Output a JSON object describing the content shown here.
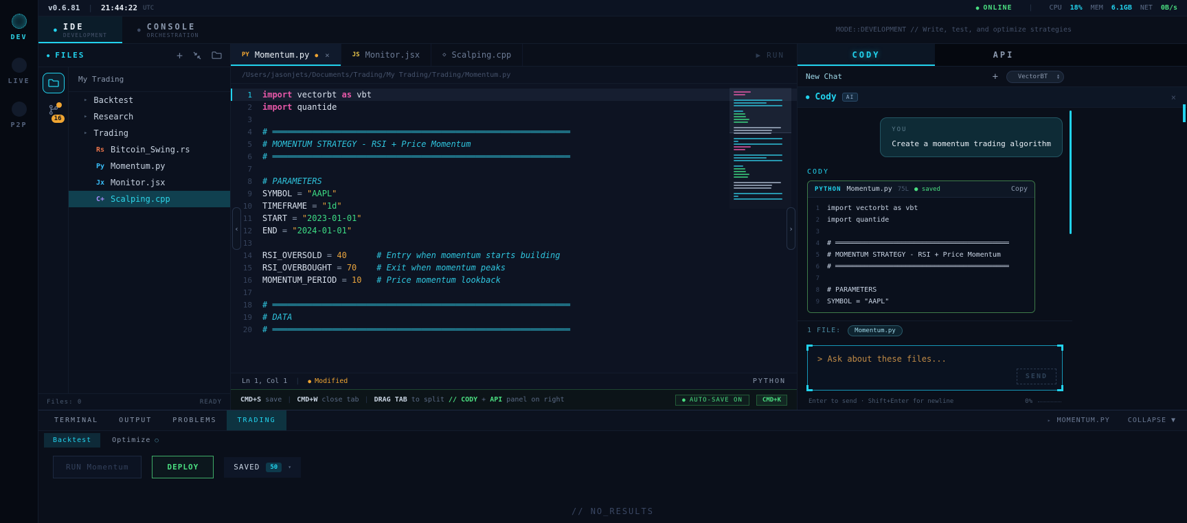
{
  "icons": {
    "close": "×",
    "plus": "+",
    "caret_right": "▸",
    "caret_down": "▾",
    "chevron_left": "‹",
    "chevron_right": "›",
    "dot": "●",
    "run": "▶",
    "diamond": "◇",
    "circle": "○",
    "collapse_caret": "▼",
    "divider": "|"
  },
  "colors": {
    "accent": "#22d3ee",
    "green": "#4ade80",
    "orange": "#f0a532"
  },
  "topbar": {
    "version": "v0.6.81",
    "time": "21:44:22",
    "timezone": "UTC",
    "online_label": "ONLINE",
    "cpu_label": "CPU",
    "cpu_value": "18%",
    "mem_label": "MEM",
    "mem_value": "6.1GB",
    "net_label": "NET",
    "net_value": "0B/s"
  },
  "rail": {
    "items": [
      {
        "label": "DEV",
        "active": true
      },
      {
        "label": "LIVE",
        "active": false
      },
      {
        "label": "P2P",
        "active": false
      }
    ]
  },
  "mode_tabs": {
    "tabs": [
      {
        "title": "IDE",
        "subtitle": "DEVELOPMENT",
        "active": true
      },
      {
        "title": "CONSOLE",
        "subtitle": "ORCHESTRATION",
        "active": false
      }
    ],
    "mode_text": "MODE::DEVELOPMENT // Write, test, and optimize strategies"
  },
  "files": {
    "header": "FILES",
    "root": "My Trading",
    "tree": [
      {
        "type": "folder",
        "name": "Backtest"
      },
      {
        "type": "folder",
        "name": "Research"
      },
      {
        "type": "folder",
        "name": "Trading"
      },
      {
        "type": "file",
        "badge": "Rs",
        "badge_color": "#e8734a",
        "name": "Bitcoin_Swing.rs"
      },
      {
        "type": "file",
        "badge": "Py",
        "badge_color": "#38bdf8",
        "name": "Momentum.py"
      },
      {
        "type": "file",
        "badge": "Jx",
        "badge_color": "#38bdf8",
        "name": "Monitor.jsx"
      },
      {
        "type": "file",
        "badge": "C+",
        "badge_color": "#a78bfa",
        "name": "Scalping.cpp",
        "selected": true
      }
    ],
    "git_badge": "16",
    "footer_left": "Files: 0",
    "footer_right": "READY"
  },
  "editor": {
    "tabs": [
      {
        "badge": "PY",
        "badge_color": "#f0a532",
        "name": "Momentum.py",
        "modified": true,
        "active": true,
        "closable": true
      },
      {
        "badge": "JS",
        "badge_color": "#e8c44a",
        "name": "Monitor.jsx",
        "modified": false,
        "active": false,
        "closable": false
      },
      {
        "badge": "◇",
        "badge_color": "#6b7a94",
        "name": "Scalping.cpp",
        "modified": false,
        "active": false,
        "closable": false
      }
    ],
    "run_label": "RUN",
    "path": "/Users/jasonjets/Documents/Trading/My Trading/Trading/Momentum.py",
    "active_line": 1,
    "code": [
      [
        {
          "t": "import",
          "c": "kw"
        },
        {
          "t": " vectorbt ",
          "c": "pl"
        },
        {
          "t": "as",
          "c": "kw"
        },
        {
          "t": " vbt",
          "c": "pl"
        }
      ],
      [
        {
          "t": "import",
          "c": "kw"
        },
        {
          "t": " quantide",
          "c": "pl"
        }
      ],
      [],
      [
        {
          "t": "# ════════════════════════════════════════════════════════════",
          "c": "cm"
        }
      ],
      [
        {
          "t": "# MOMENTUM STRATEGY - RSI + Price Momentum",
          "c": "cm"
        }
      ],
      [
        {
          "t": "# ════════════════════════════════════════════════════════════",
          "c": "cm"
        }
      ],
      [],
      [
        {
          "t": "# PARAMETERS",
          "c": "cm"
        }
      ],
      [
        {
          "t": "SYMBOL ",
          "c": "pl"
        },
        {
          "t": "= ",
          "c": "op"
        },
        {
          "t": "\"",
          "c": "qt"
        },
        {
          "t": "AAPL",
          "c": "str"
        },
        {
          "t": "\"",
          "c": "qt"
        }
      ],
      [
        {
          "t": "TIMEFRAME ",
          "c": "pl"
        },
        {
          "t": "= ",
          "c": "op"
        },
        {
          "t": "\"",
          "c": "qt"
        },
        {
          "t": "1d",
          "c": "str"
        },
        {
          "t": "\"",
          "c": "qt"
        }
      ],
      [
        {
          "t": "START ",
          "c": "pl"
        },
        {
          "t": "= ",
          "c": "op"
        },
        {
          "t": "\"",
          "c": "qt"
        },
        {
          "t": "2023-01-01",
          "c": "str"
        },
        {
          "t": "\"",
          "c": "qt"
        }
      ],
      [
        {
          "t": "END ",
          "c": "pl"
        },
        {
          "t": "= ",
          "c": "op"
        },
        {
          "t": "\"",
          "c": "qt"
        },
        {
          "t": "2024-01-01",
          "c": "str"
        },
        {
          "t": "\"",
          "c": "qt"
        }
      ],
      [],
      [
        {
          "t": "RSI_OVERSOLD ",
          "c": "pl"
        },
        {
          "t": "= ",
          "c": "op"
        },
        {
          "t": "40",
          "c": "num"
        },
        {
          "t": "      ",
          "c": "pl"
        },
        {
          "t": "# Entry when momentum starts building",
          "c": "cm"
        }
      ],
      [
        {
          "t": "RSI_OVERBOUGHT ",
          "c": "pl"
        },
        {
          "t": "= ",
          "c": "op"
        },
        {
          "t": "70",
          "c": "num"
        },
        {
          "t": "    ",
          "c": "pl"
        },
        {
          "t": "# Exit when momentum peaks",
          "c": "cm"
        }
      ],
      [
        {
          "t": "MOMENTUM_PERIOD ",
          "c": "pl"
        },
        {
          "t": "= ",
          "c": "op"
        },
        {
          "t": "10",
          "c": "num"
        },
        {
          "t": "   ",
          "c": "pl"
        },
        {
          "t": "# Price momentum lookback",
          "c": "cm"
        }
      ],
      [],
      [
        {
          "t": "# ════════════════════════════════════════════════════════════",
          "c": "cm"
        }
      ],
      [
        {
          "t": "# DATA",
          "c": "cm"
        }
      ],
      [
        {
          "t": "# ════════════════════════════════════════════════════════════",
          "c": "cm"
        }
      ]
    ],
    "status": {
      "position": "Ln 1, Col 1",
      "modified_label": "Modified",
      "language": "PYTHON"
    },
    "hints": [
      {
        "t": "CMD+S",
        "c": "key"
      },
      {
        "t": " save",
        "c": "dim"
      },
      {
        "t": "|",
        "c": "sep"
      },
      {
        "t": "CMD+W",
        "c": "key"
      },
      {
        "t": " close tab",
        "c": "dim"
      },
      {
        "t": "|",
        "c": "sep"
      },
      {
        "t": "DRAG TAB",
        "c": "key"
      },
      {
        "t": " to split ",
        "c": "dim"
      },
      {
        "t": "// ",
        "c": "grn"
      },
      {
        "t": "CODY",
        "c": "grn"
      },
      {
        "t": " + ",
        "c": "dim"
      },
      {
        "t": "API",
        "c": "grn"
      },
      {
        "t": " panel on right",
        "c": "dim"
      }
    ],
    "autosave_label": "AUTO-SAVE ON",
    "cmdk_label": "CMD+K"
  },
  "cody": {
    "tabs": [
      {
        "label": "CODY",
        "active": true
      },
      {
        "label": "API",
        "active": false
      }
    ],
    "new_chat_label": "New Chat",
    "model_select": "VectorBT",
    "assistant_name": "Cody",
    "assistant_badge": "AI",
    "user_label": "YOU",
    "user_message": "Create a momentum trading algorithm",
    "response_label": "CODY",
    "code_block": {
      "lang": "PYTHON",
      "file": "Momentum.py",
      "line_count": "75L",
      "save_status": "saved",
      "copy_label": "Copy",
      "code": [
        "import vectorbt as vbt",
        "import quantide",
        "",
        "# ══════════════════════════════════════════",
        "# MOMENTUM STRATEGY - RSI + Price Momentum",
        "# ══════════════════════════════════════════",
        "",
        "# PARAMETERS",
        "SYMBOL = \"AAPL\""
      ]
    },
    "files_label": "1 FILE:",
    "file_chip": "Momentum.py",
    "input": {
      "placeholder": "> Ask about these files...",
      "send_label": "SEND"
    },
    "footer_left": "Enter to send · Shift+Enter for newline",
    "footer_right": "0%"
  },
  "bottom": {
    "tabs": [
      {
        "label": "TERMINAL",
        "active": false
      },
      {
        "label": "OUTPUT",
        "active": false
      },
      {
        "label": "PROBLEMS",
        "active": false
      },
      {
        "label": "TRADING",
        "active": true
      }
    ],
    "right_file": "MOMENTUM.PY",
    "collapse_label": "COLLAPSE",
    "subtabs": [
      {
        "label": "Backtest",
        "active": true
      },
      {
        "label": "Optimize",
        "active": false,
        "icon": "circle"
      }
    ],
    "run_button": "RUN Momentum",
    "deploy_button": "DEPLOY",
    "saved_label": "SAVED",
    "saved_count": "50",
    "no_results": "// NO_RESULTS"
  }
}
